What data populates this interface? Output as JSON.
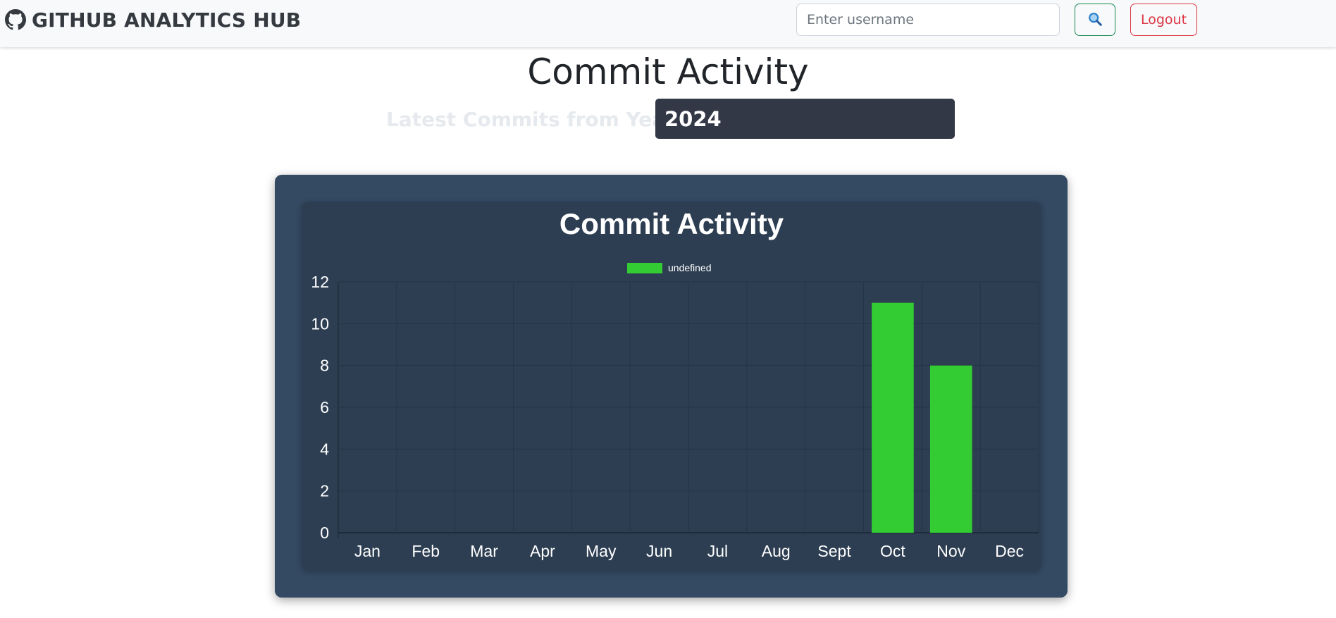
{
  "navbar": {
    "brand": "GITHUB ANALYTICS HUB",
    "brand_icon": "github-icon",
    "search_placeholder": "Enter username",
    "search_value": "",
    "search_icon": "magnifier-icon",
    "logout_label": "Logout"
  },
  "page": {
    "title": "Commit Activity",
    "year_label": "Latest Commits from Year:",
    "year_value": "2024"
  },
  "colors": {
    "bar": "#33cc33",
    "card_bg": "#344a62",
    "chart_bg": "#2d3e52",
    "logout": "#dc3545",
    "search_border": "#198754"
  },
  "chart_data": {
    "type": "bar",
    "title": "Commit Activity",
    "legend": [
      "undefined"
    ],
    "legend_position": "top-center",
    "categories": [
      "Jan",
      "Feb",
      "Mar",
      "Apr",
      "May",
      "Jun",
      "Jul",
      "Aug",
      "Sept",
      "Oct",
      "Nov",
      "Dec"
    ],
    "series": [
      {
        "name": "undefined",
        "values": [
          0,
          0,
          0,
          0,
          0,
          0,
          0,
          0,
          0,
          11,
          8,
          0
        ]
      }
    ],
    "ylim": [
      0,
      12
    ],
    "yticks": [
      0,
      2,
      4,
      6,
      8,
      10,
      12
    ],
    "grid": true,
    "xlabel": "",
    "ylabel": ""
  }
}
